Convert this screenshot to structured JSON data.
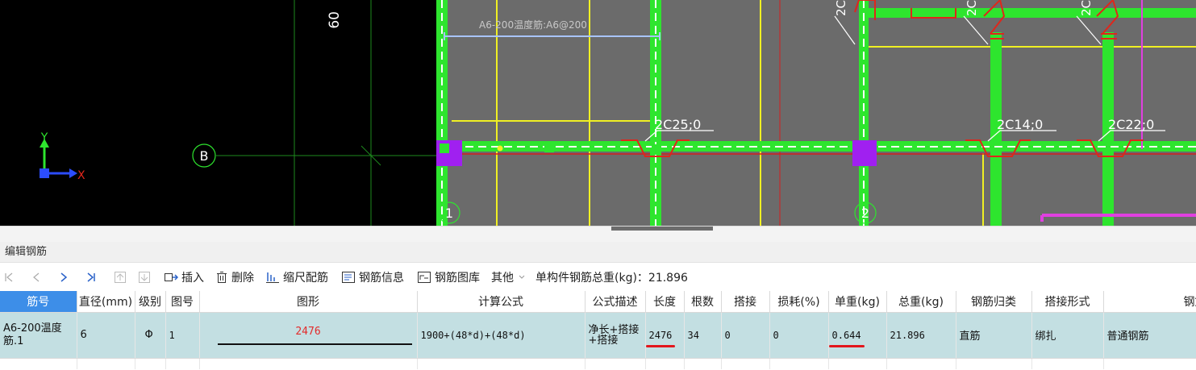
{
  "drawing": {
    "axis_labels": [
      "B",
      "1",
      "2"
    ],
    "dimension_text": "60",
    "rebar_note": "A6-200温度筋:A6@200",
    "rebar_tags": [
      "2C25;0",
      "2C14;0",
      "2C22;0"
    ],
    "top_tags": [
      "2C",
      "2C",
      "2C"
    ],
    "coord_x": "X",
    "coord_y": "Y",
    "colors": {
      "background": "#000000",
      "slab_fill": "#6b6b6b",
      "beam": "#2ee52e",
      "axis_line": "#d41d1d",
      "rebar": "#f0f023",
      "column": "#a020f0",
      "annotation": "#ffffff",
      "grid_line": "#1e8a1e",
      "magenta": "#e040e0"
    }
  },
  "panel": {
    "title": "编辑钢筋"
  },
  "toolbar": {
    "insert": "插入",
    "delete": "删除",
    "scale": "缩尺配筋",
    "info": "钢筋信息",
    "library": "钢筋图库",
    "other": "其他",
    "total_label": "单构件钢筋总重(kg)：21.896"
  },
  "table": {
    "headers": {
      "id": "筋号",
      "diameter": "直径(mm)",
      "grade": "级别",
      "shape_no": "图号",
      "shape": "图形",
      "formula": "计算公式",
      "formula_desc": "公式描述",
      "length": "长度",
      "count": "根数",
      "lap": "搭接",
      "loss": "损耗(%)",
      "unit_weight": "单重(kg)",
      "total_weight": "总重(kg)",
      "category": "钢筋归类",
      "lap_type": "搭接形式",
      "rebar_type": "钢筋"
    },
    "row": {
      "id": "A6-200温度筋.1",
      "diameter": "6",
      "grade": "Φ",
      "shape_no": "1",
      "shape_length": "2476",
      "formula": "1900+(48*d)+(48*d)",
      "formula_desc": "净长+搭接+搭接",
      "length": "2476",
      "count": "34",
      "lap": "0",
      "loss": "0",
      "unit_weight": "0.644",
      "total_weight": "21.896",
      "category": "直筋",
      "lap_type": "绑扎",
      "rebar_type": "普通钢筋"
    },
    "highlight_color": "#e3161c",
    "header_highlight_color": "#3d8ee8"
  }
}
